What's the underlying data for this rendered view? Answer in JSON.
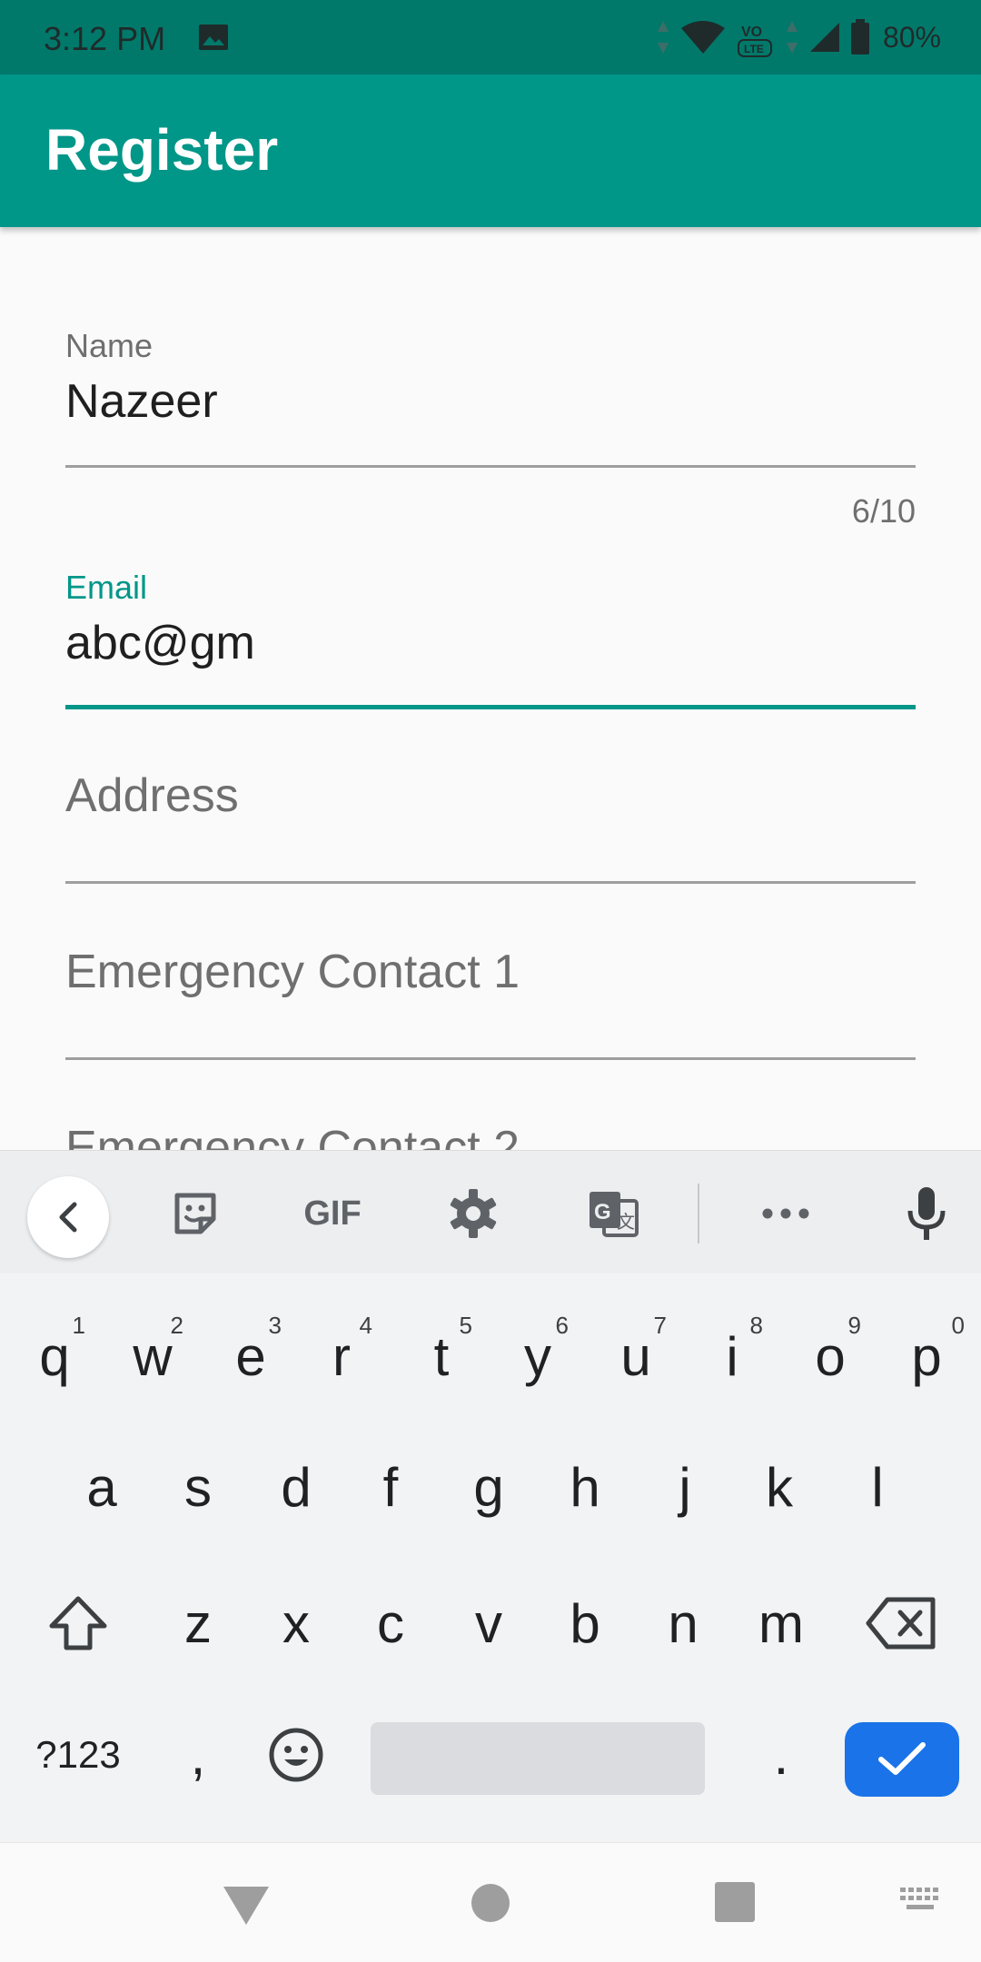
{
  "status_bar": {
    "time": "3:12 PM",
    "battery": "80%",
    "icons": [
      "gallery-icon",
      "data-arrows-icon",
      "wifi-icon",
      "volte-icon",
      "signal-icon",
      "battery-icon"
    ]
  },
  "app_bar": {
    "title": "Register",
    "color": "#009688"
  },
  "form": {
    "name": {
      "label": "Name",
      "value": "Nazeer",
      "counter": "6/10"
    },
    "email": {
      "label": "Email",
      "value": "abc@gm",
      "focused": true
    },
    "address": {
      "hint": "Address"
    },
    "emergency1": {
      "hint": "Emergency Contact 1"
    },
    "emergency2": {
      "hint": "Emergency Contact 2"
    }
  },
  "keyboard": {
    "toolbar": [
      "back-icon",
      "sticker-icon",
      "GIF",
      "gear-icon",
      "translate-icon",
      "more-icon",
      "mic-icon"
    ],
    "gif_label": "GIF",
    "row1": [
      {
        "k": "q",
        "n": "1"
      },
      {
        "k": "w",
        "n": "2"
      },
      {
        "k": "e",
        "n": "3"
      },
      {
        "k": "r",
        "n": "4"
      },
      {
        "k": "t",
        "n": "5"
      },
      {
        "k": "y",
        "n": "6"
      },
      {
        "k": "u",
        "n": "7"
      },
      {
        "k": "i",
        "n": "8"
      },
      {
        "k": "o",
        "n": "9"
      },
      {
        "k": "p",
        "n": "0"
      }
    ],
    "row2": [
      "a",
      "s",
      "d",
      "f",
      "g",
      "h",
      "j",
      "k",
      "l"
    ],
    "row3": [
      "z",
      "x",
      "c",
      "v",
      "b",
      "n",
      "m"
    ],
    "symbols_label": "?123",
    "comma": ",",
    "period": ".",
    "enter_color": "#1a73e8"
  },
  "nav_bar": {
    "icons": [
      "back-triangle-icon",
      "home-circle-icon",
      "recents-square-icon",
      "keyboard-switch-icon"
    ]
  }
}
